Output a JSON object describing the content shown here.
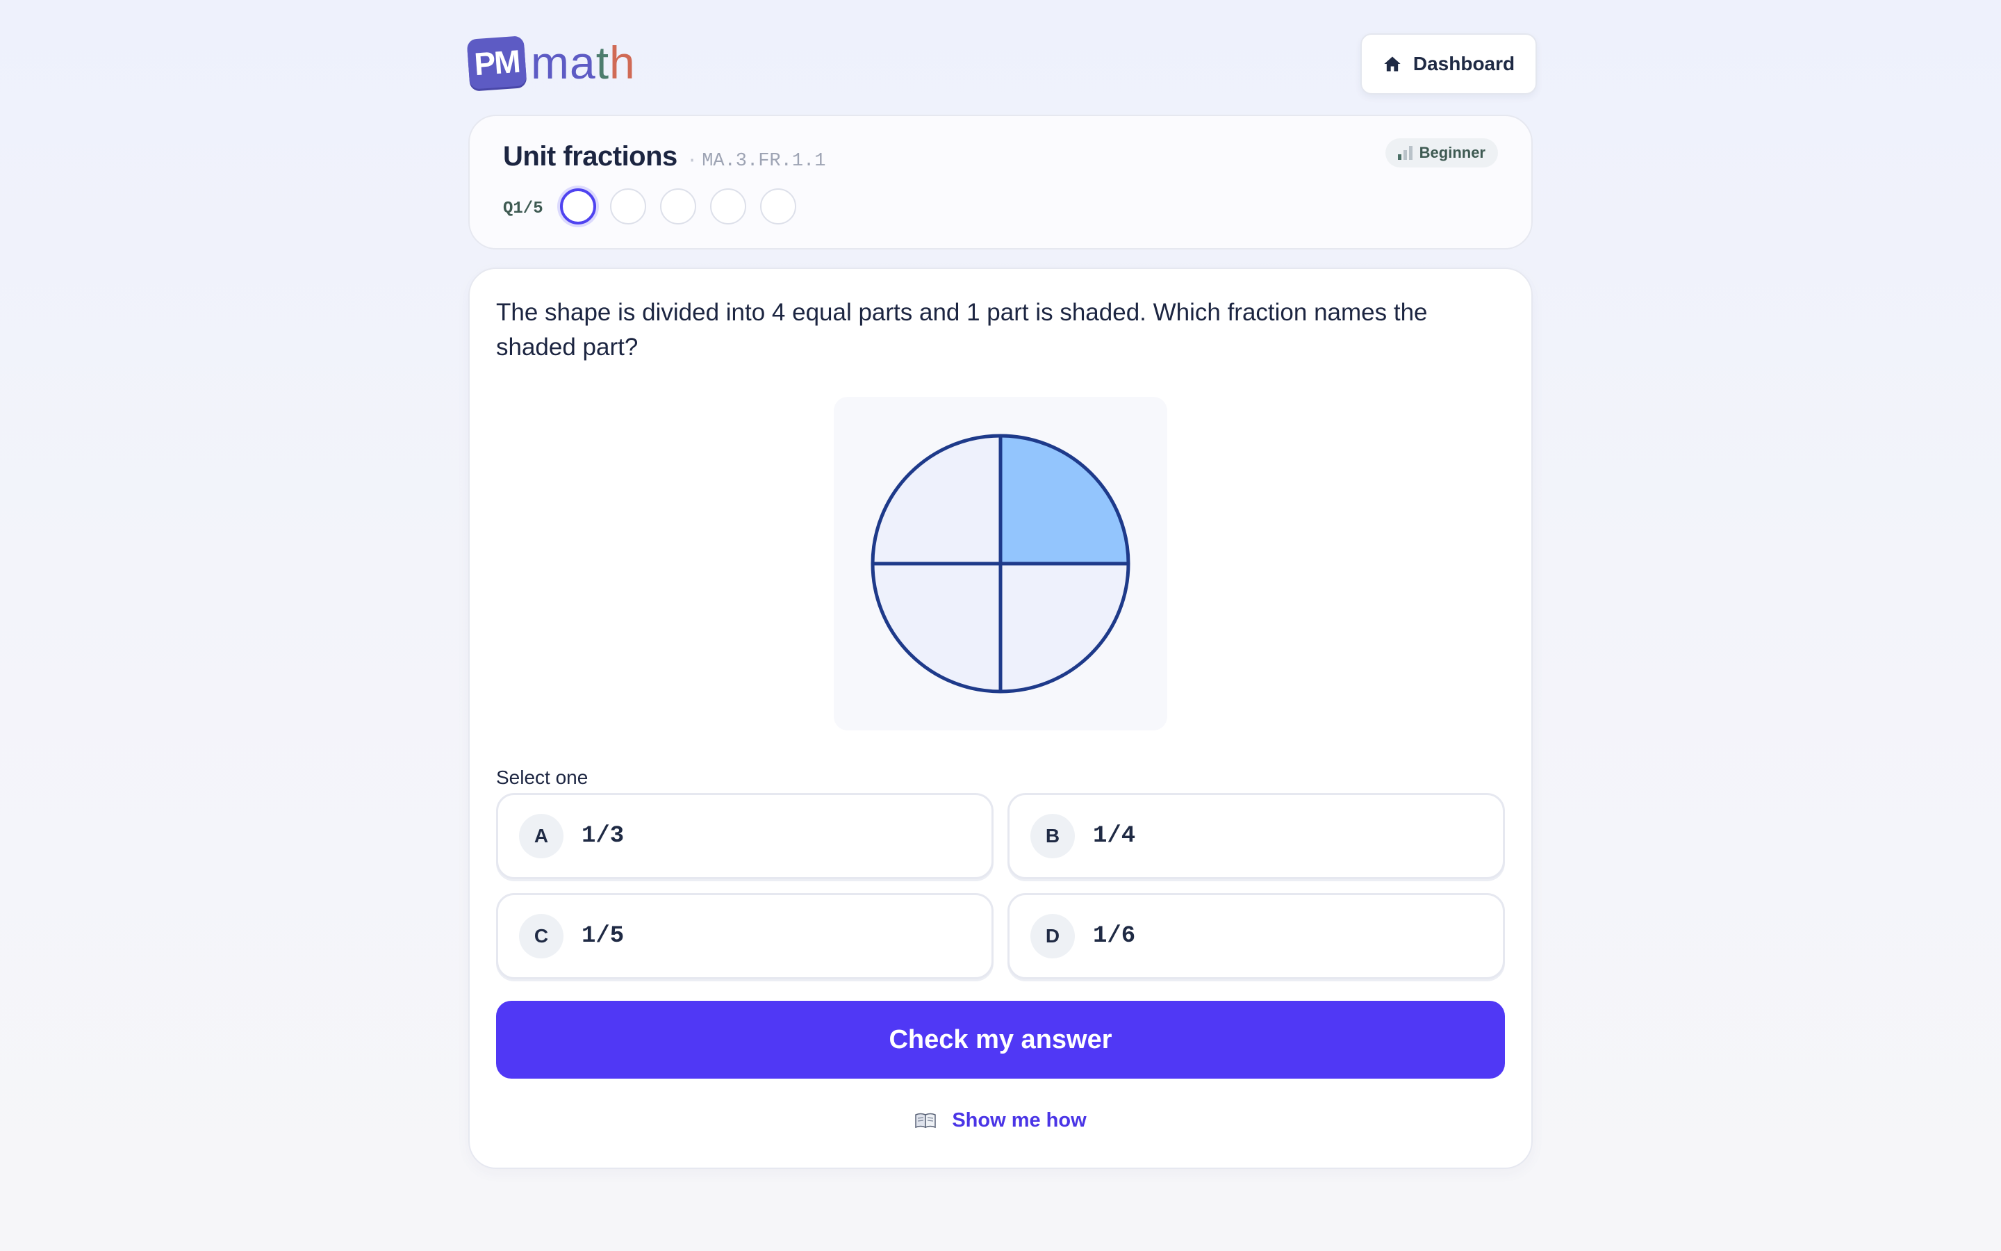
{
  "brand": {
    "badge": "PM",
    "word_a": "ma",
    "word_t": "t",
    "word_h": "h"
  },
  "header": {
    "dashboard_label": "Dashboard",
    "dashboard_icon": "home-icon"
  },
  "unit": {
    "title": "Unit fractions",
    "separator": "·",
    "code": "MA.3.FR.1.1",
    "level": "Beginner",
    "level_icon": "signal-bars-icon",
    "question_counter": "Q1/5",
    "total_questions": 5,
    "current_question": 1
  },
  "question": {
    "text": "The shape is divided into 4 equal parts and 1 part is shaded. Which fraction names the shaded part?",
    "figure": {
      "total_parts": 4,
      "shaded_parts": 1,
      "shape": "circle"
    },
    "select_label": "Select one",
    "options": [
      {
        "letter": "A",
        "value": "1/3"
      },
      {
        "letter": "B",
        "value": "1/4"
      },
      {
        "letter": "C",
        "value": "1/5"
      },
      {
        "letter": "D",
        "value": "1/6"
      }
    ],
    "check_label": "Check my answer",
    "help_label": "Show me how",
    "help_icon": "book-icon"
  },
  "colors": {
    "accent": "#5038f5",
    "brand_purple": "#5d5bc4",
    "shaded_fill": "#93c5fd",
    "unshaded_fill": "#eef1fc",
    "figure_stroke": "#1e3a8a"
  }
}
